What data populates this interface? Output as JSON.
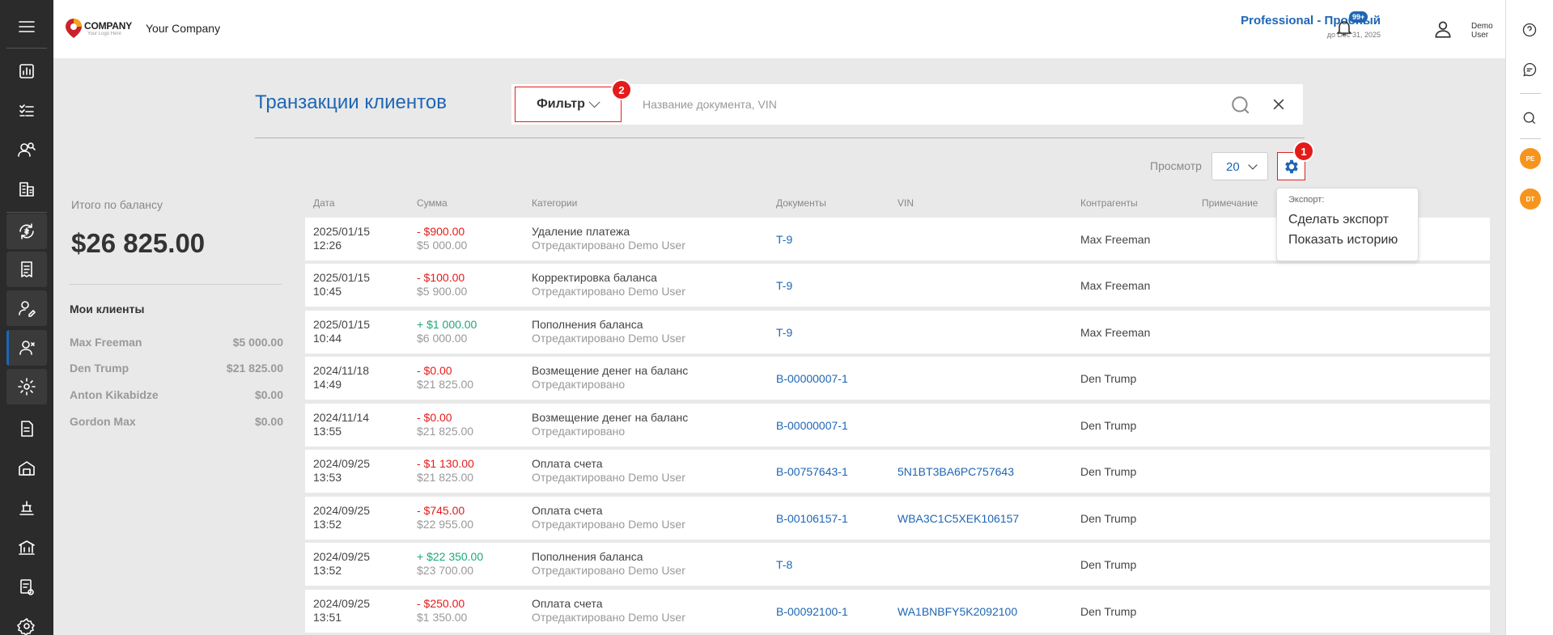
{
  "app": {
    "company_name": "Your Company",
    "logo_text": "COMPANY",
    "logo_sub": "Your Logo Here"
  },
  "header": {
    "plan": "Professional - Пробный",
    "plan_date": "до Dec 31, 2025",
    "notif_badge": "99+",
    "user_line1": "Demo",
    "user_line2": "User"
  },
  "page": {
    "title": "Транзакции клиентов"
  },
  "search": {
    "filter_label": "Фильтр",
    "placeholder": "Название документа, VIN",
    "value": ""
  },
  "steps": {
    "one": "1",
    "two": "2"
  },
  "view": {
    "label": "Просмотр",
    "value": "20"
  },
  "export_menu": {
    "header": "Экспорт:",
    "items": [
      "Сделать экспорт",
      "Показать историю"
    ]
  },
  "balance": {
    "label": "Итого по балансу",
    "value": "$26 825.00"
  },
  "clients": {
    "title": "Мои клиенты",
    "items": [
      {
        "name": "Max Freeman",
        "amount": "$5 000.00"
      },
      {
        "name": "Den Trump",
        "amount": "$21 825.00"
      },
      {
        "name": "Anton Kikabidze",
        "amount": "$0.00"
      },
      {
        "name": "Gordon Max",
        "amount": "$0.00"
      }
    ]
  },
  "table": {
    "headers": {
      "date": "Дата",
      "amount": "Сумма",
      "category": "Категории",
      "documents": "Документы",
      "vin": "VIN",
      "counterparty": "Контрагенты",
      "note": "Примечание"
    },
    "rows": [
      {
        "date": "2025/01/15",
        "time": "12:26",
        "amount": "- $900.00",
        "sign": "neg",
        "balance": "$5 000.00",
        "category": "Удаление платежа",
        "edited": "Отредактировано Demo User",
        "doc": "T-9",
        "vin": "",
        "counterparty": "Max Freeman"
      },
      {
        "date": "2025/01/15",
        "time": "10:45",
        "amount": "- $100.00",
        "sign": "neg",
        "balance": "$5 900.00",
        "category": "Корректировка баланса",
        "edited": "Отредактировано Demo User",
        "doc": "T-9",
        "vin": "",
        "counterparty": "Max Freeman"
      },
      {
        "date": "2025/01/15",
        "time": "10:44",
        "amount": "+ $1 000.00",
        "sign": "pos",
        "balance": "$6 000.00",
        "category": "Пополнения баланса",
        "edited": "Отредактировано Demo User",
        "doc": "T-9",
        "vin": "",
        "counterparty": "Max Freeman"
      },
      {
        "date": "2024/11/18",
        "time": "14:49",
        "amount": "- $0.00",
        "sign": "neg",
        "balance": "$21 825.00",
        "category": "Возмещение денег на баланс",
        "edited": "Отредактировано",
        "doc": "B-00000007-1",
        "vin": "",
        "counterparty": "Den Trump"
      },
      {
        "date": "2024/11/14",
        "time": "13:55",
        "amount": "- $0.00",
        "sign": "neg",
        "balance": "$21 825.00",
        "category": "Возмещение денег на баланс",
        "edited": "Отредактировано",
        "doc": "B-00000007-1",
        "vin": "",
        "counterparty": "Den Trump"
      },
      {
        "date": "2024/09/25",
        "time": "13:53",
        "amount": "- $1 130.00",
        "sign": "neg",
        "balance": "$21 825.00",
        "category": "Оплата счета",
        "edited": "Отредактировано Demo User",
        "doc": "B-00757643-1",
        "vin": "5N1BT3BA6PC757643",
        "counterparty": "Den Trump"
      },
      {
        "date": "2024/09/25",
        "time": "13:52",
        "amount": "- $745.00",
        "sign": "neg",
        "balance": "$22 955.00",
        "category": "Оплата счета",
        "edited": "Отредактировано Demo User",
        "doc": "B-00106157-1",
        "vin": "WBA3C1C5XEK106157",
        "counterparty": "Den Trump"
      },
      {
        "date": "2024/09/25",
        "time": "13:52",
        "amount": "+ $22 350.00",
        "sign": "pos",
        "balance": "$23 700.00",
        "category": "Пополнения баланса",
        "edited": "Отредактировано Demo User",
        "doc": "T-8",
        "vin": "",
        "counterparty": "Den Trump"
      },
      {
        "date": "2024/09/25",
        "time": "13:51",
        "amount": "- $250.00",
        "sign": "neg",
        "balance": "$1 350.00",
        "category": "Оплата счета",
        "edited": "Отредактировано Demo User",
        "doc": "B-00092100-1",
        "vin": "WA1BNBFY5K2092100",
        "counterparty": "Den Trump"
      }
    ]
  },
  "rightbar": {
    "avatars": [
      "PE",
      "DT"
    ]
  },
  "colors": {
    "accent": "#1e66b4",
    "negative": "#e41b1b",
    "positive": "#1ea87c",
    "avatar": "#f7941d",
    "sidebar": "#2b2b2b"
  }
}
